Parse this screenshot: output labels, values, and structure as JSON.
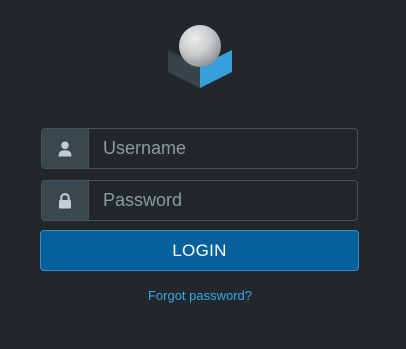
{
  "logo": {
    "icon": "roundcube-logo-icon",
    "colors": {
      "sphere_light": "#e3e4e5",
      "sphere_dark": "#9ea1a4",
      "box_left": "#37444c",
      "box_right": "#37a0dc"
    }
  },
  "form": {
    "username": {
      "icon": "user-icon",
      "placeholder": "Username",
      "value": ""
    },
    "password": {
      "icon": "lock-icon",
      "placeholder": "Password",
      "value": ""
    },
    "login_label": "LOGIN",
    "forgot_label": "Forgot password?"
  },
  "colors": {
    "background": "#21272b",
    "field_border": "#46535b",
    "addon_background": "#3a474e",
    "button": "#05619c",
    "link": "#37a9e8"
  }
}
